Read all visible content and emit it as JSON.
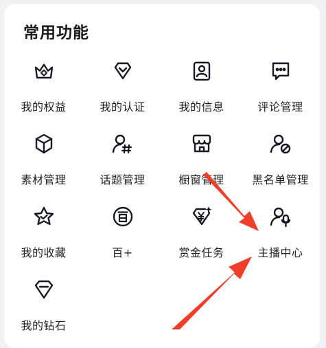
{
  "section": {
    "title": "常用功能"
  },
  "colors": {
    "arrow": "#f03e2a",
    "icon": "#161823",
    "text": "#222222"
  },
  "items": [
    {
      "label": "我的权益",
      "icon": "crown-icon"
    },
    {
      "label": "我的认证",
      "icon": "verified-badge-icon"
    },
    {
      "label": "我的信息",
      "icon": "profile-card-icon"
    },
    {
      "label": "评论管理",
      "icon": "comment-bubble-icon"
    },
    {
      "label": "素材管理",
      "icon": "cube-icon"
    },
    {
      "label": "话题管理",
      "icon": "topic-hashtag-icon"
    },
    {
      "label": "橱窗管理",
      "icon": "storefront-icon"
    },
    {
      "label": "黑名单管理",
      "icon": "blocked-user-icon"
    },
    {
      "label": "我的收藏",
      "icon": "star-check-icon"
    },
    {
      "label": "百+",
      "icon": "bai-circle-icon"
    },
    {
      "label": "赏金任务",
      "icon": "bounty-yen-icon"
    },
    {
      "label": "主播中心",
      "icon": "streamer-mic-icon"
    },
    {
      "label": "我的钻石",
      "icon": "diamond-icon"
    }
  ]
}
